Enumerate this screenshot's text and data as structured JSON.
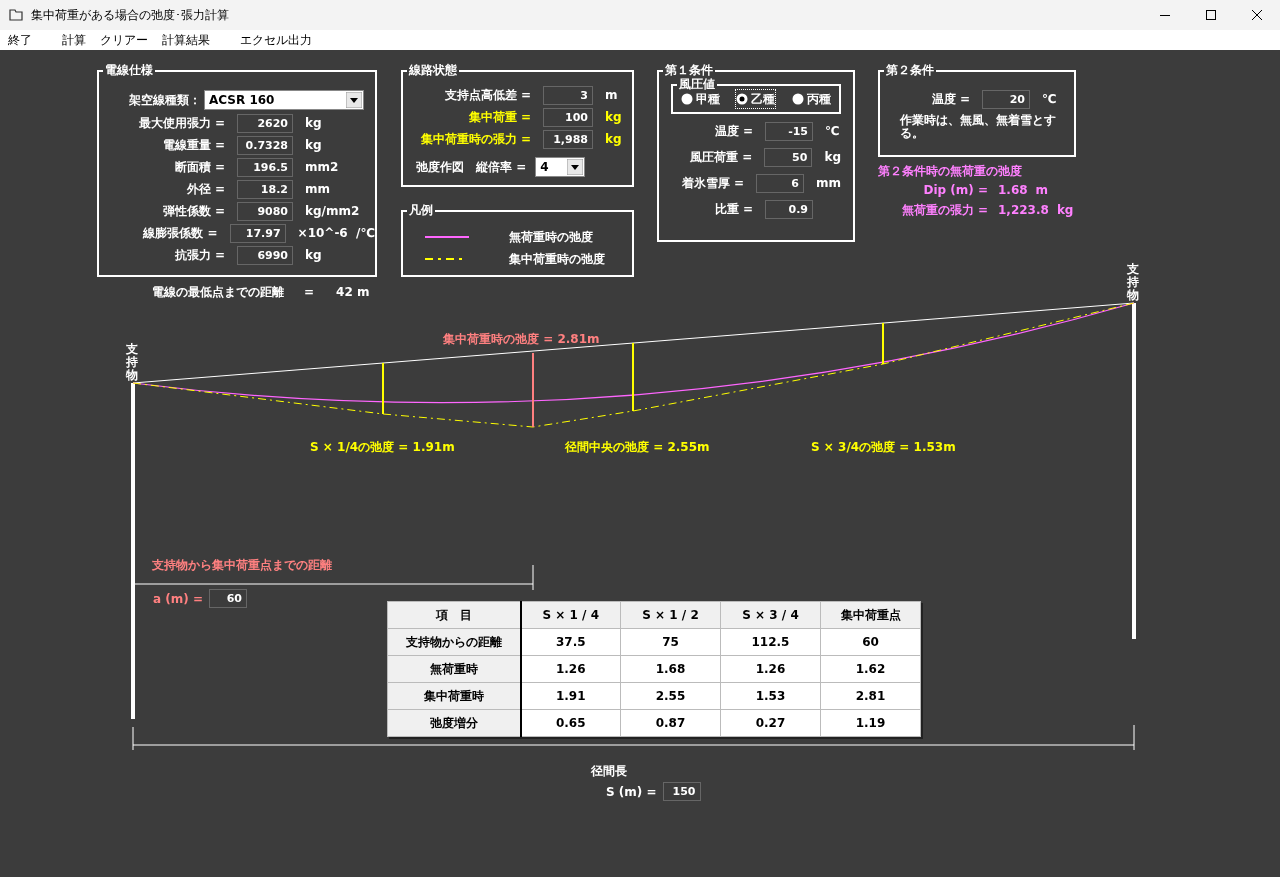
{
  "window": {
    "title": "集中荷重がある場合の弛度･張力計算"
  },
  "menu": [
    {
      "label": "終了"
    },
    {
      "label": "計算"
    },
    {
      "label": "クリアー"
    },
    {
      "label": "計算結果"
    },
    {
      "label": "エクセル出力"
    }
  ],
  "wire_spec": {
    "title": "電線仕様",
    "cable_type": {
      "label": "架空線種類：",
      "value": "ACSR 160"
    },
    "fields": [
      {
        "label": "最大使用張力 =",
        "value": "2620",
        "unit": "kg"
      },
      {
        "label": "電線重量 =",
        "value": "0.7328",
        "unit": "kg"
      },
      {
        "label": "断面積 =",
        "value": "196.5",
        "unit": "mm2"
      },
      {
        "label": "外径 =",
        "value": "18.2",
        "unit": "mm"
      },
      {
        "label": "弾性係数 =",
        "value": "9080",
        "unit": "kg/mm2"
      },
      {
        "label": "線膨張係数 =",
        "value": "17.97",
        "unit": "×10^-6  /℃"
      },
      {
        "label": "抗張力 =",
        "value": "6990",
        "unit": "kg"
      }
    ]
  },
  "lowest_point": {
    "label": "電線の最低点までの距離",
    "equals": "=",
    "value": "42 m"
  },
  "line_state": {
    "title": "線路状態",
    "fields": [
      {
        "label": "支持点高低差 =",
        "value": "3",
        "unit": "m",
        "highlight": false
      },
      {
        "label": "集中荷重 =",
        "value": "100",
        "unit": "kg",
        "highlight": true
      },
      {
        "label": "集中荷重時の張力 =",
        "value": "1,988",
        "unit": "kg",
        "highlight": true
      }
    ],
    "scale": {
      "label": "弛度作図",
      "sublabel": "縦倍率 =",
      "value": "4"
    }
  },
  "legend": {
    "title": "凡例",
    "items": [
      {
        "kind": "solid",
        "color": "#ff66ff",
        "label": "無荷重時の弛度"
      },
      {
        "kind": "dashdot",
        "color": "#ffff00",
        "label": "集中荷重時の弛度"
      }
    ]
  },
  "condition1": {
    "title": "第１条件",
    "wind_pressure": {
      "title": "風圧値",
      "options": [
        {
          "label": "甲種",
          "selected": false
        },
        {
          "label": "乙種",
          "selected": true
        },
        {
          "label": "丙種",
          "selected": false
        }
      ]
    },
    "fields": [
      {
        "label": "温度 =",
        "value": "-15",
        "unit": "℃"
      },
      {
        "label": "風圧荷重 =",
        "value": "50",
        "unit": "kg"
      },
      {
        "label": "着氷雪厚 =",
        "value": "6",
        "unit": "mm"
      },
      {
        "label": "比重 =",
        "value": "0.9"
      }
    ]
  },
  "condition2": {
    "title": "第２条件",
    "field": {
      "label": "温度 =",
      "value": "20",
      "unit": "℃"
    },
    "note": "作業時は、無風、無着雪とする。",
    "result_title": "第２条件時の無荷重の弛度",
    "results": [
      {
        "label": "Dip (m) =",
        "value": "1.68",
        "unit": "m"
      },
      {
        "label": "無荷重の張力 =",
        "value": "1,223.8",
        "unit": "kg"
      }
    ]
  },
  "diagram": {
    "support_left": "支持物",
    "support_right": "支持物",
    "load_dip": "集中荷重時の弛度 = 2.81m",
    "dips": [
      {
        "label": "S × 1/4の弛度 = 1.91m"
      },
      {
        "label": "径間中央の弛度 = 2.55m"
      },
      {
        "label": "S × 3/4の弛度 = 1.53m"
      }
    ],
    "load_distance": {
      "title": "支持物から集中荷重点までの距離",
      "label": "a (m) =",
      "value": "60"
    },
    "span": {
      "title": "径間長",
      "label": "S (m) =",
      "value": "150"
    }
  },
  "table": {
    "columns": [
      "項　目",
      "S × 1 / 4",
      "S × 1 / 2",
      "S × 3 / 4",
      "集中荷重点"
    ],
    "rows": [
      {
        "cells": [
          "支持物からの距離",
          "37.5",
          "75",
          "112.5",
          "60"
        ]
      },
      {
        "cells": [
          "無荷重時",
          "1.26",
          "1.68",
          "1.26",
          "1.62"
        ]
      },
      {
        "cells": [
          "集中荷重時",
          "1.91",
          "2.55",
          "1.53",
          "2.81"
        ]
      },
      {
        "cells": [
          "弛度増分",
          "0.65",
          "0.87",
          "0.27",
          "1.19"
        ]
      }
    ]
  }
}
